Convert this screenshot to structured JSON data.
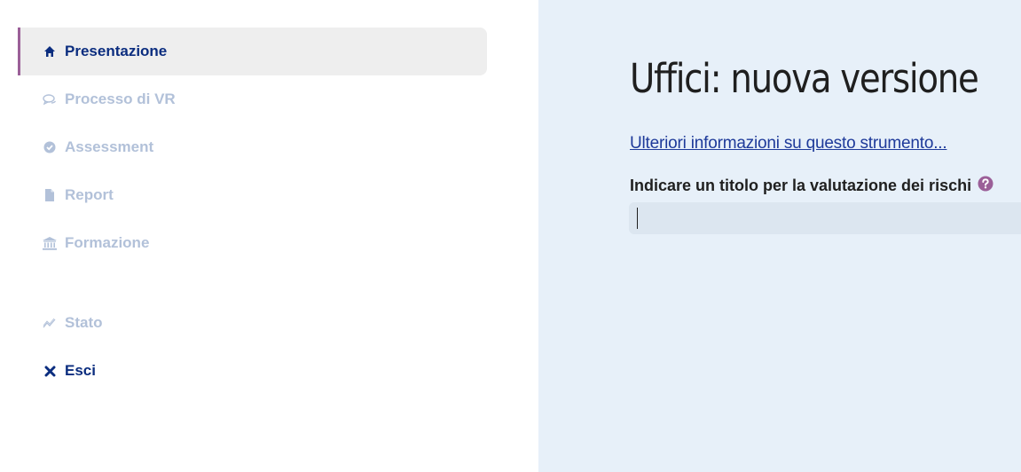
{
  "sidebar": {
    "items": [
      {
        "label": "Presentazione",
        "icon": "home-icon"
      },
      {
        "label": "Processo di VR",
        "icon": "chat-icon"
      },
      {
        "label": "Assessment",
        "icon": "check-circle-icon"
      },
      {
        "label": "Report",
        "icon": "file-icon"
      },
      {
        "label": "Formazione",
        "icon": "institution-icon"
      },
      {
        "label": "Stato",
        "icon": "chart-line-icon"
      },
      {
        "label": "Esci",
        "icon": "close-icon"
      }
    ]
  },
  "main": {
    "title": "Uffici: nuova versione",
    "more_link": "Ulteriori informazioni su questo strumento...",
    "field_label": "Indicare un titolo per la valutazione dei rischi",
    "input_value": ""
  },
  "colors": {
    "primary": "#0b2d7f",
    "accent": "#9b5f98",
    "disabled": "#b2c1d9",
    "main_background": "#e7f0f9"
  }
}
